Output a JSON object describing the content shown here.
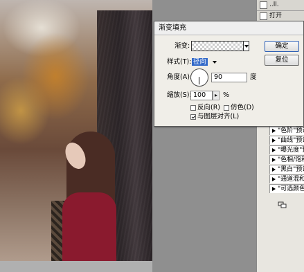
{
  "window": {
    "title": "渐变填充"
  },
  "top_panel": {
    "item1_label": "..ll.",
    "item2_label": "打开"
  },
  "dialog": {
    "gradient_label": "渐变:",
    "style_label": "样式(T):",
    "style_value": "径向",
    "angle_label": "角度(A):",
    "angle_value": "90",
    "angle_unit": "度",
    "scale_label": "缩放(S):",
    "scale_value": "100",
    "scale_unit": "%",
    "reverse_label": "反向(R)",
    "reverse_checked": false,
    "dither_label": "仿色(D)",
    "dither_checked": false,
    "align_label": "与图层对齐(L)",
    "align_checked": true,
    "ok_label": "确定",
    "reset_label": "复位"
  },
  "adjustments_panel": {
    "items": [
      {
        "label": "\"色阶\"预设"
      },
      {
        "label": "\"曲线\"预设"
      },
      {
        "label": "\"曝光度\"预"
      },
      {
        "label": "\"色相/饱和"
      },
      {
        "label": "\"黑白\"预设"
      },
      {
        "label": "\"通道混和器"
      },
      {
        "label": "\"可选颜色\""
      }
    ],
    "footer_icon": "layers-icon"
  },
  "colors": {
    "selection_blue": "#3168c8",
    "dialog_bg": "#f0eee8",
    "sweater": "#8a1a2e"
  }
}
